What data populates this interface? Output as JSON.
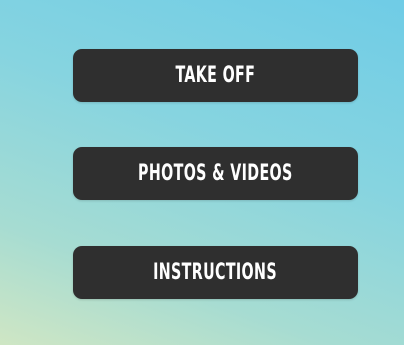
{
  "menu": {
    "take_off_label": "TAKE OFF",
    "photos_videos_label": "PHOTOS & VIDEOS",
    "instructions_label": "INSTRUCTIONS"
  },
  "colors": {
    "button_background": "#2f2f2f",
    "button_text": "#ffffff",
    "background_gradient_start": "#6fcce6",
    "background_gradient_end": "#cfe6c4"
  }
}
